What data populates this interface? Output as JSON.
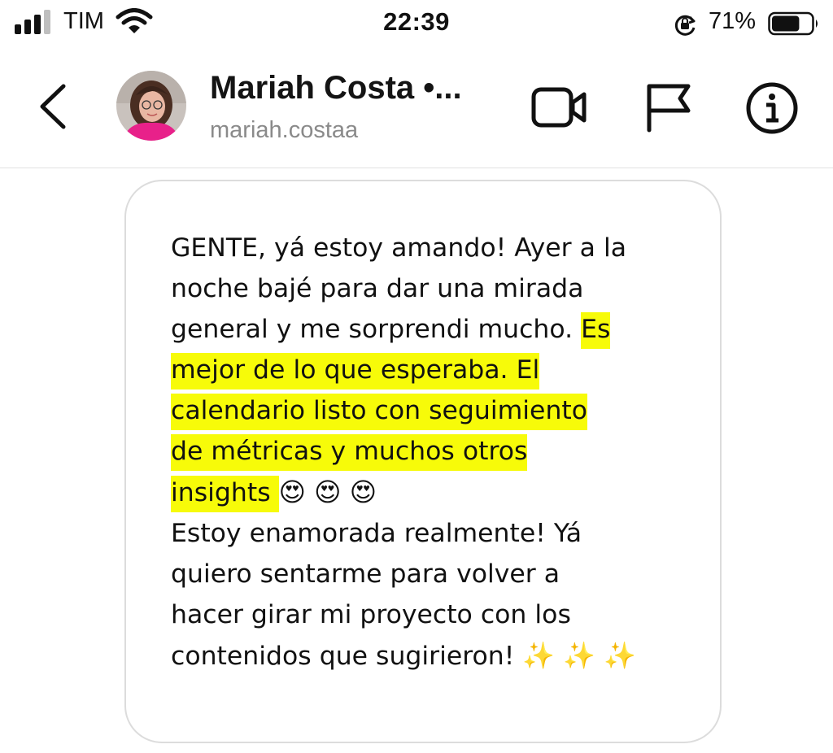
{
  "status_bar": {
    "carrier": "TIM",
    "time": "22:39",
    "battery_percent": "71%",
    "signal_bars": 3,
    "signal_bars_total": 4,
    "battery_level": 0.71,
    "icons": [
      "signal-icon",
      "wifi-icon",
      "rotation-lock-icon",
      "battery-icon"
    ]
  },
  "header": {
    "contact_name": "Mariah Costa •...",
    "contact_handle": "mariah.costaa",
    "icons": [
      "back-chevron-icon",
      "avatar",
      "video-call-icon",
      "flag-icon",
      "info-icon"
    ]
  },
  "message": {
    "line1": "GENTE, yá estoy amando! Ayer a la",
    "line2": "noche bajé para dar una mirada",
    "line3a": "general y me sorprendi mucho. ",
    "line3b": "Es ",
    "line4": "mejor de lo que esperaba. El ",
    "line5": "calendario listo con seguimiento ",
    "line6": "de métricas y muchos otros ",
    "line7a": "insights ",
    "line7b": " 😍  😍  😍",
    "line8": "Estoy enamorada realmente! Yá",
    "line9": "quiero sentarme para volver a",
    "line10": "hacer girar mi proyecto con los",
    "line11a": "contenidos que sugirieron! ",
    "line11b": " ✨ ✨ ✨"
  },
  "colors": {
    "highlight": "#f7fb09",
    "secondary_text": "#8a8a8a",
    "bubble_border": "#dcdcdc"
  }
}
